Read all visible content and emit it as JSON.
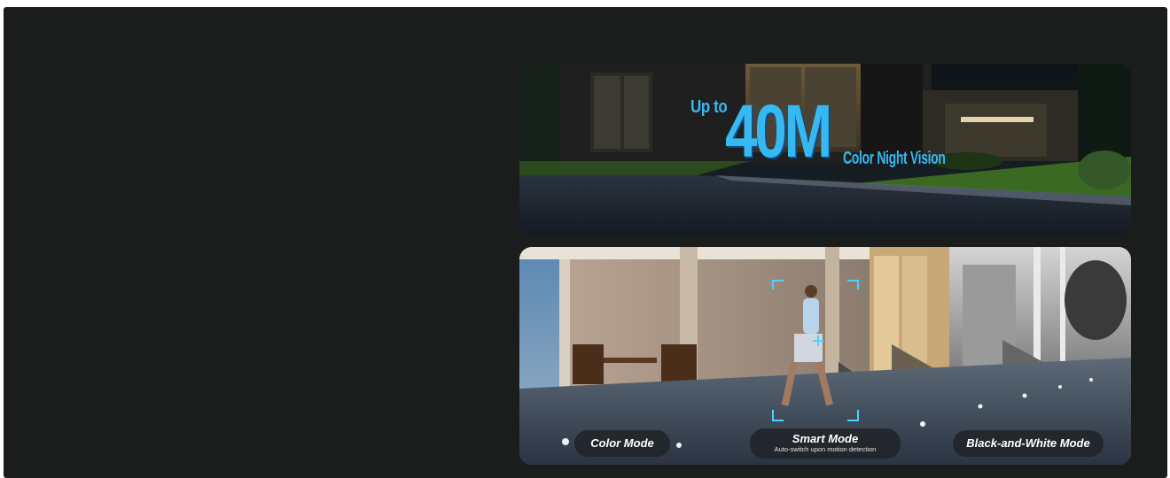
{
  "banner_top": {
    "prefix": "Up to",
    "value": "40M",
    "suffix": "Color Night Vision"
  },
  "banner_bottom": {
    "modes": [
      {
        "label": "Color Mode",
        "sub": ""
      },
      {
        "label": "Smart Mode",
        "sub": "Auto-switch upon motion detection"
      },
      {
        "label": "Black-and-White Mode",
        "sub": ""
      }
    ]
  },
  "colors": {
    "background": "#1b1c1c",
    "accent": "#36b8f2"
  }
}
